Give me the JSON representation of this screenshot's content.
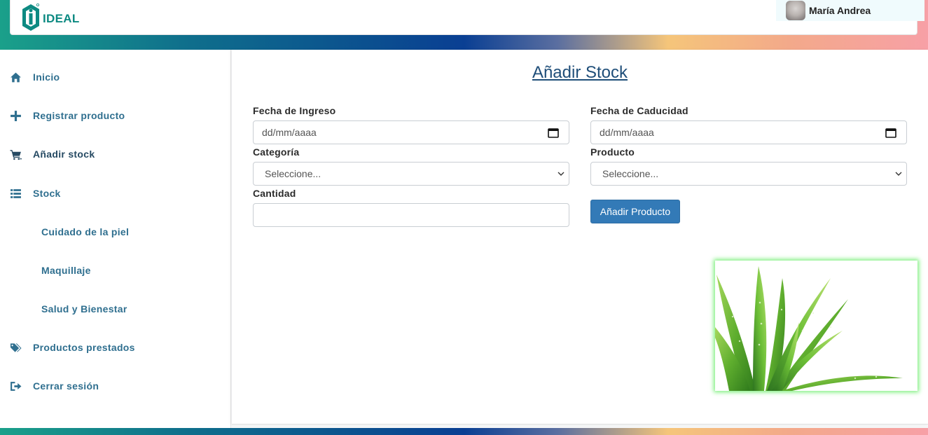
{
  "header": {
    "logo_text": "IDEAL",
    "user_name": "María Andrea"
  },
  "sidebar": {
    "items": [
      {
        "label": "Inicio",
        "icon": "home-icon"
      },
      {
        "label": "Registrar producto",
        "icon": "plus-icon"
      },
      {
        "label": "Añadir stock",
        "icon": "cart-icon"
      },
      {
        "label": "Stock",
        "icon": "list-icon"
      },
      {
        "label": "Cuidado de la piel",
        "icon": ""
      },
      {
        "label": "Maquillaje",
        "icon": ""
      },
      {
        "label": "Salud y Bienestar",
        "icon": ""
      },
      {
        "label": "Productos prestados",
        "icon": "tags-icon"
      },
      {
        "label": "Cerrar sesión",
        "icon": "logout-icon"
      }
    ]
  },
  "main": {
    "title": "Añadir Stock",
    "fecha_ingreso": {
      "label": "Fecha de Ingreso",
      "placeholder": "dd/mm/aaaa"
    },
    "fecha_caducidad": {
      "label": "Fecha de Caducidad",
      "placeholder": "dd/mm/aaaa"
    },
    "categoria": {
      "label": "Categoría",
      "selected": "Seleccione..."
    },
    "producto": {
      "label": "Producto",
      "selected": "Seleccione..."
    },
    "cantidad": {
      "label": "Cantidad",
      "value": ""
    },
    "submit_label": "Añadir Producto"
  },
  "colors": {
    "accent": "#337ab7",
    "nav_text": "#2f6f8f",
    "title": "#1f4e79",
    "image_glow": "#7cf07c"
  }
}
